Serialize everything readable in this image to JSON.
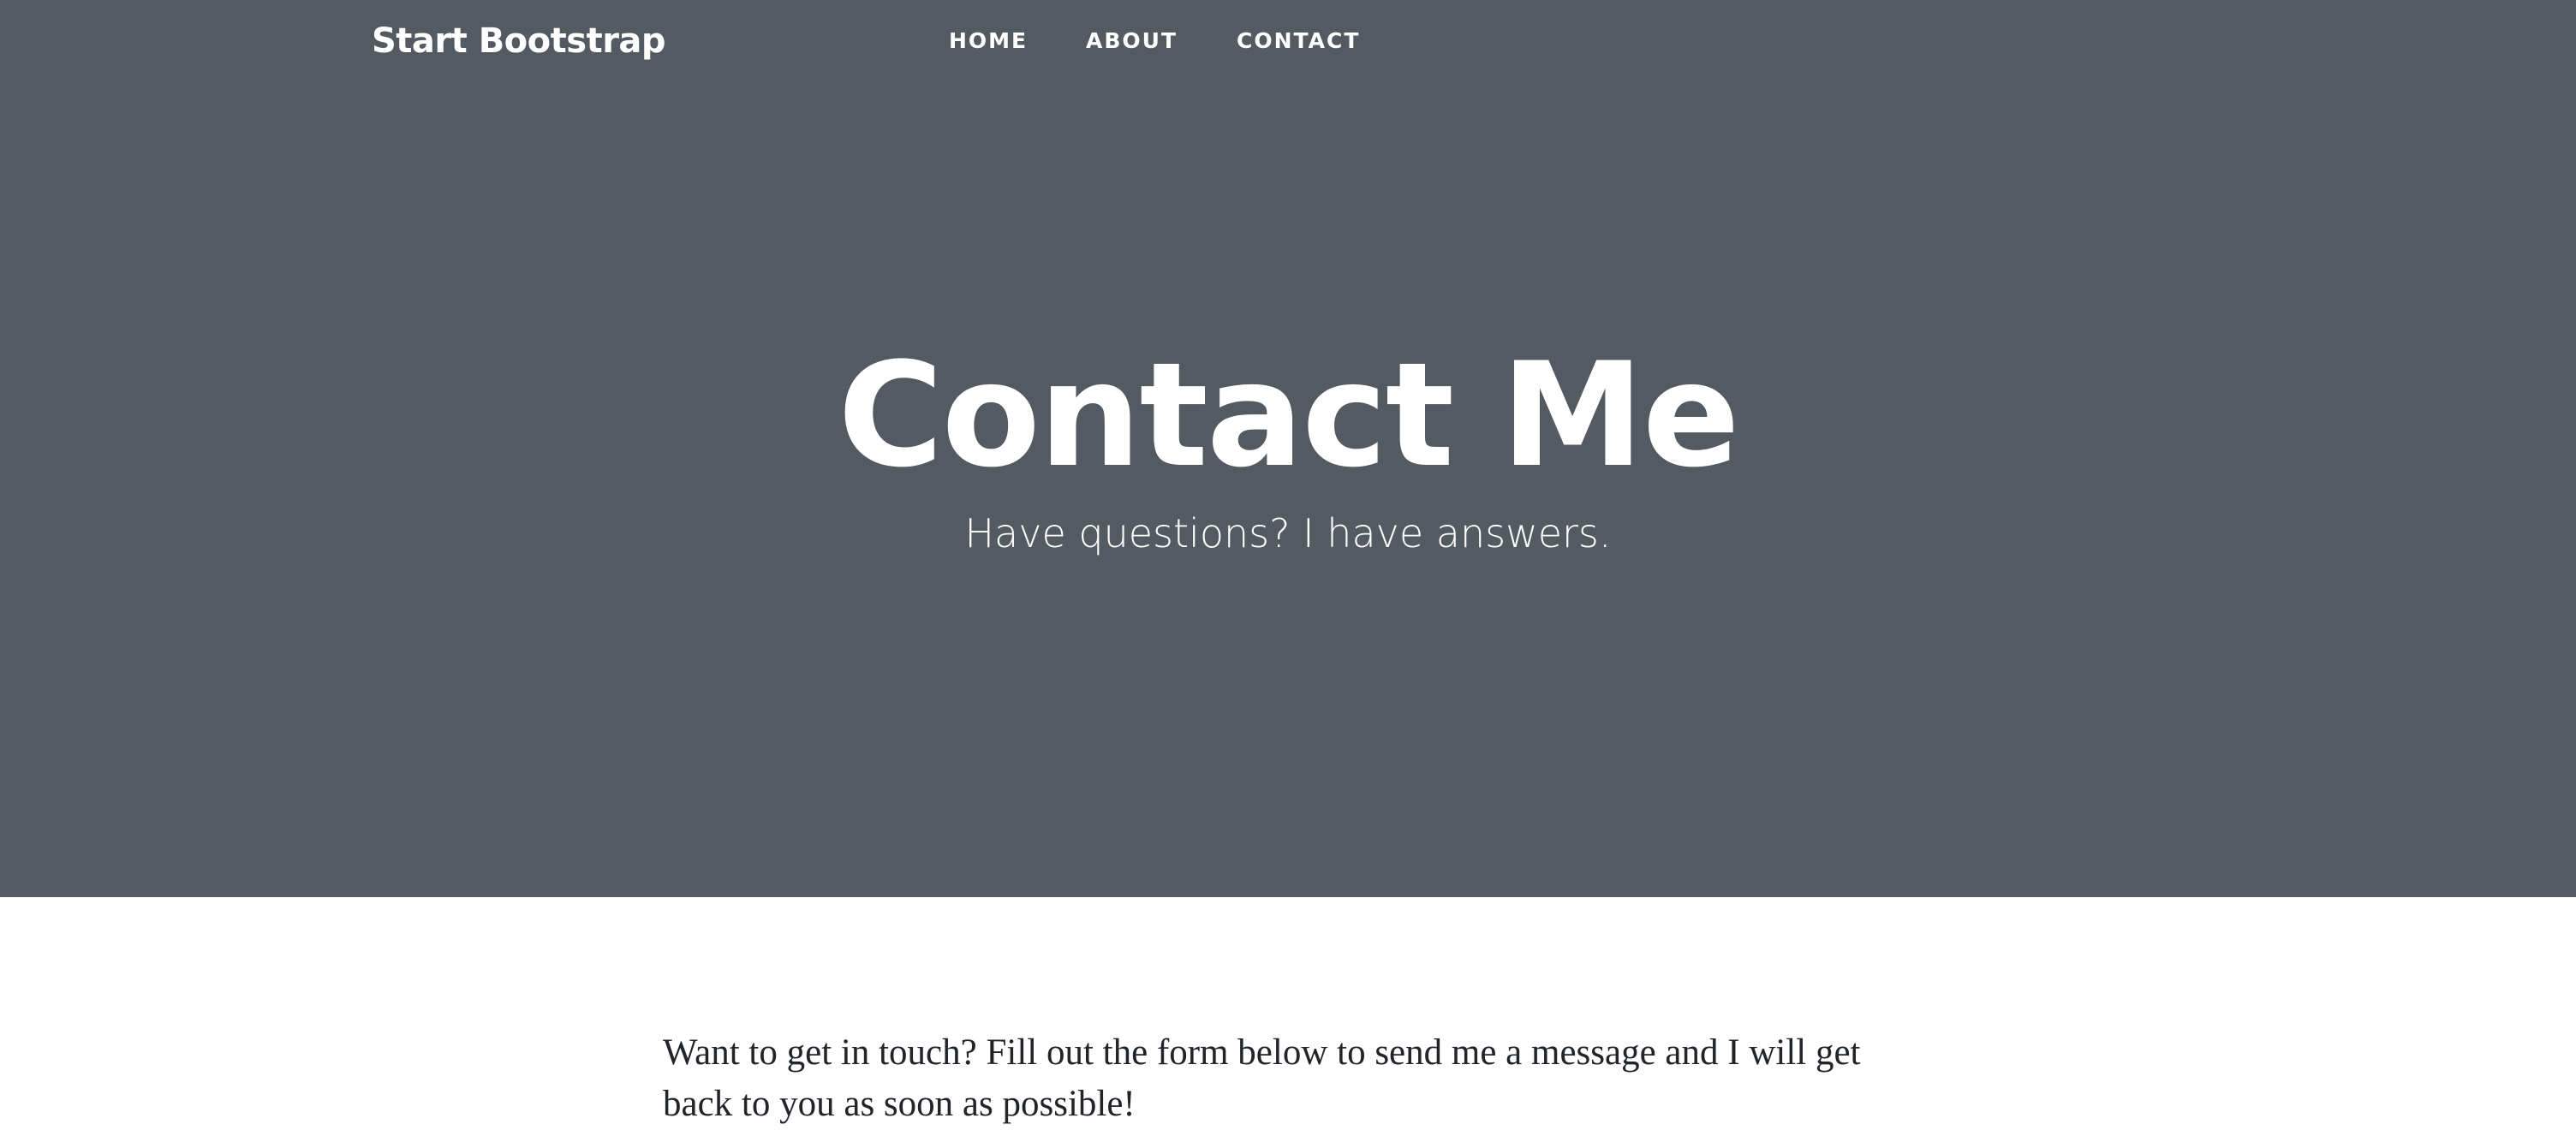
{
  "navbar": {
    "brand": "Start Bootstrap",
    "links": [
      {
        "label": "HOME"
      },
      {
        "label": "ABOUT"
      },
      {
        "label": "CONTACT"
      }
    ]
  },
  "hero": {
    "title": "Contact Me",
    "subtitle": "Have questions? I have answers."
  },
  "content": {
    "intro": "Want to get in touch? Fill out the form below to send me a message and I will get back to you as soon as possible!"
  },
  "colors": {
    "hero_background": "#535a62",
    "text_on_hero": "#ffffff",
    "body_text": "#212529",
    "page_background": "#ffffff"
  }
}
